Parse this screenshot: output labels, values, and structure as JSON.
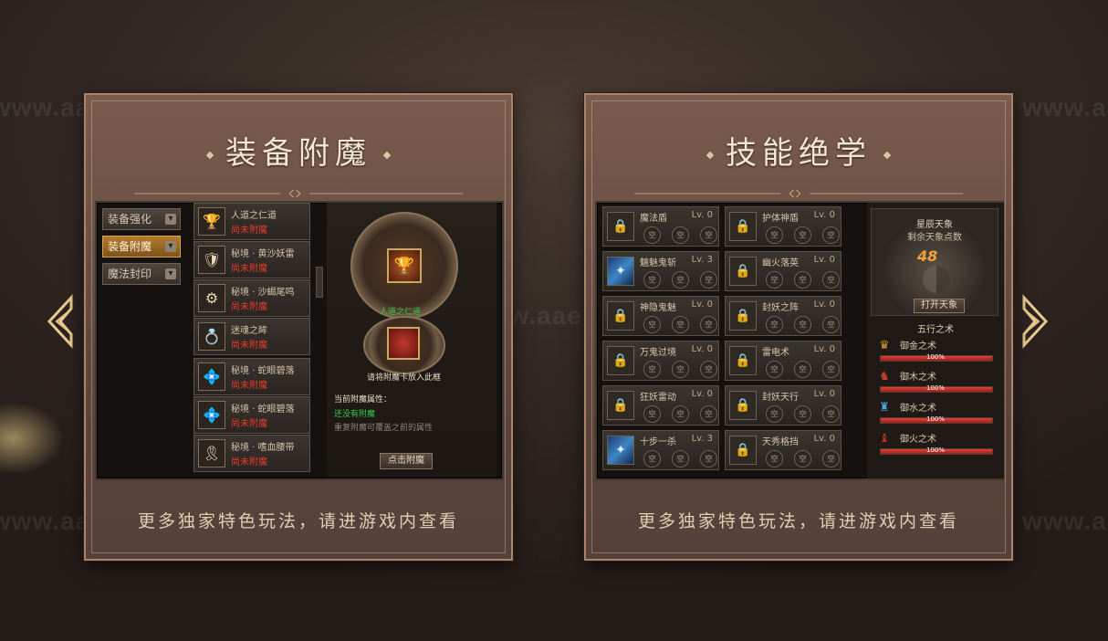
{
  "watermark": "www.aae.ink",
  "left_panel": {
    "title": "装备附魔",
    "footer": "更多独家特色玩法，请进游戏内查看",
    "tabs": [
      {
        "label": "装备强化",
        "active": false
      },
      {
        "label": "装备附魔",
        "active": true
      },
      {
        "label": "魔法封印",
        "active": false
      }
    ],
    "items": [
      {
        "name": "人道之仁道",
        "status": "尚未附魔",
        "icon": "🏆"
      },
      {
        "name": "秘境 · 黄沙妖雷",
        "status": "尚未附魔",
        "icon": "🛡"
      },
      {
        "name": "秘境 · 沙蝎尾鸣",
        "status": "尚未附魔",
        "icon": "⚙"
      },
      {
        "name": "迷魂之眸",
        "status": "尚未附魔",
        "icon": "💍"
      },
      {
        "name": "秘境 · 蛇眼碧落",
        "status": "尚未附魔",
        "icon": "💠"
      },
      {
        "name": "秘境 · 蛇眼碧落",
        "status": "尚未附魔",
        "icon": "💠"
      },
      {
        "name": "秘境 · 嗜血腰带",
        "status": "尚未附魔",
        "icon": "🎗"
      }
    ],
    "selected_name": "人道之仁道",
    "slot_hint": "请将附魔卡放入此框",
    "attr_title": "当前附魔属性：",
    "attr_value": "还没有附魔",
    "attr_note": "重复附魔可覆盖之前的属性",
    "enchant_button": "点击附魔"
  },
  "right_panel": {
    "title": "技能绝学",
    "footer": "更多独家特色玩法，请进游戏内查看",
    "slot_label": "空",
    "skills": [
      {
        "name": "魔法盾",
        "level": "Lv. 0",
        "unlocked": false
      },
      {
        "name": "护体神盾",
        "level": "Lv. 0",
        "unlocked": false
      },
      {
        "name": "魑魅鬼斩",
        "level": "Lv. 3",
        "unlocked": true
      },
      {
        "name": "幽火落英",
        "level": "Lv. 0",
        "unlocked": false
      },
      {
        "name": "神隐鬼魅",
        "level": "Lv. 0",
        "unlocked": false
      },
      {
        "name": "封妖之阵",
        "level": "Lv. 0",
        "unlocked": false
      },
      {
        "name": "万鬼过境",
        "level": "Lv. 0",
        "unlocked": false
      },
      {
        "name": "雷电术",
        "level": "Lv. 0",
        "unlocked": false
      },
      {
        "name": "狂妖雷动",
        "level": "Lv. 0",
        "unlocked": false
      },
      {
        "name": "封妖天行",
        "level": "Lv. 0",
        "unlocked": false
      },
      {
        "name": "十步一杀",
        "level": "Lv. 3",
        "unlocked": true
      },
      {
        "name": "天秀格挡",
        "level": "Lv. 0",
        "unlocked": false
      }
    ],
    "star": {
      "title": "星辰天象",
      "points_label": "剩余天象点数",
      "points": "48",
      "open_button": "打开天象"
    },
    "elements_title": "五行之术",
    "elements": [
      {
        "name": "御金之术",
        "percent": "100%",
        "value": 1.0,
        "icon": "♛",
        "color": "#d99a3c"
      },
      {
        "name": "御木之术",
        "percent": "100%",
        "value": 1.0,
        "icon": "♞",
        "color": "#c0402f"
      },
      {
        "name": "御水之术",
        "percent": "100%",
        "value": 1.0,
        "icon": "♜",
        "color": "#4aa3d8"
      },
      {
        "name": "御火之术",
        "percent": "100%",
        "value": 1.0,
        "icon": "♝",
        "color": "#c0302a"
      }
    ]
  }
}
